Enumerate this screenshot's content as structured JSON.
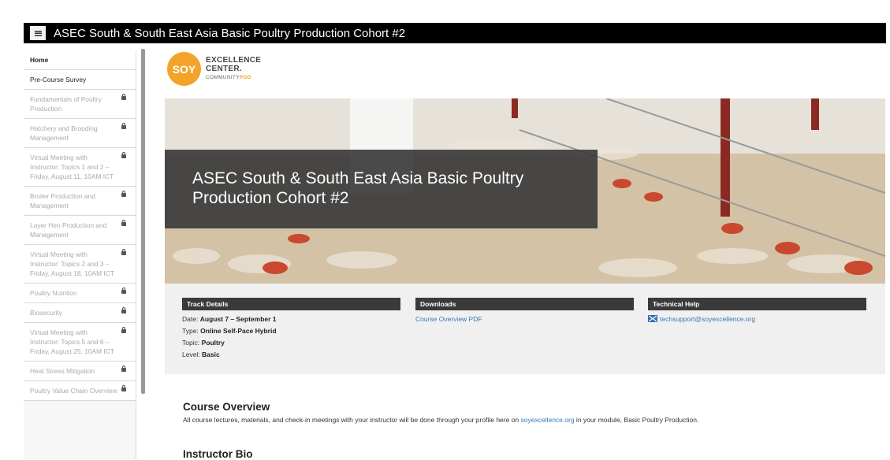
{
  "header": {
    "title": "ASEC South & South East Asia Basic Poultry Production Cohort #2",
    "menu_icon": "menu-icon"
  },
  "sidebar": {
    "items": [
      {
        "label": "Home",
        "state": "active",
        "locked": false
      },
      {
        "label": "Pre-Course Survey",
        "state": "open",
        "locked": false
      },
      {
        "label": "Fundamentals of Poultry Production",
        "state": "locked",
        "locked": true
      },
      {
        "label": "Hatchery and Brooding Management",
        "state": "locked",
        "locked": true
      },
      {
        "label": "Virtual Meeting with Instructor: Topics 1 and 2 – Friday, August 11, 10AM ICT",
        "state": "locked",
        "locked": true
      },
      {
        "label": "Broiler Production and Management",
        "state": "locked",
        "locked": true
      },
      {
        "label": "Layer Hen Production and Management",
        "state": "locked",
        "locked": true
      },
      {
        "label": "Virtual Meeting with Instructor: Topics 2 and 3 – Friday, August 18, 10AM ICT",
        "state": "locked",
        "locked": true
      },
      {
        "label": "Poultry Nutrition",
        "state": "locked",
        "locked": true
      },
      {
        "label": "Biosecurity",
        "state": "locked",
        "locked": true
      },
      {
        "label": "Virtual Meeting with Instructor: Topics 5 and 6 – Friday, August 25, 10AM ICT",
        "state": "locked",
        "locked": true
      },
      {
        "label": "Heat Stress Mitigation",
        "state": "locked",
        "locked": true
      },
      {
        "label": "Poultry Value Chain Overview",
        "state": "locked",
        "locked": true
      }
    ]
  },
  "logo": {
    "mark": "SOY",
    "line1": "EXCELLENCE",
    "line2": "CENTER.",
    "community": "COMMUNITY",
    "pod": "POD"
  },
  "hero": {
    "title": "ASEC South & South East Asia Basic Poultry Production Cohort #2"
  },
  "track": {
    "heading": "Track Details",
    "date_label": "Date: ",
    "date_value": "August 7 – September 1",
    "type_label": "Type: ",
    "type_value": "Online Self-Pace Hybrid",
    "topic_label": "Topic: ",
    "topic_value": "Poultry",
    "level_label": "Level: ",
    "level_value": "Basic"
  },
  "downloads": {
    "heading": "Downloads",
    "link": "Course Overview PDF"
  },
  "help": {
    "heading": "Technical Help",
    "email": "techsupport@soyexcellence.org"
  },
  "overview": {
    "heading": "Course Overview",
    "text_before": "All course lectures, materials, and check-in meetings with your instructor will be done through your profile here on ",
    "link": "soyexcellence.org",
    "text_after": " in your module, Basic Poultry Production."
  },
  "bio": {
    "heading": "Instructor Bio"
  },
  "colors": {
    "accent": "#f4a32a",
    "link": "#3a78b5",
    "header_bg": "#000000"
  }
}
